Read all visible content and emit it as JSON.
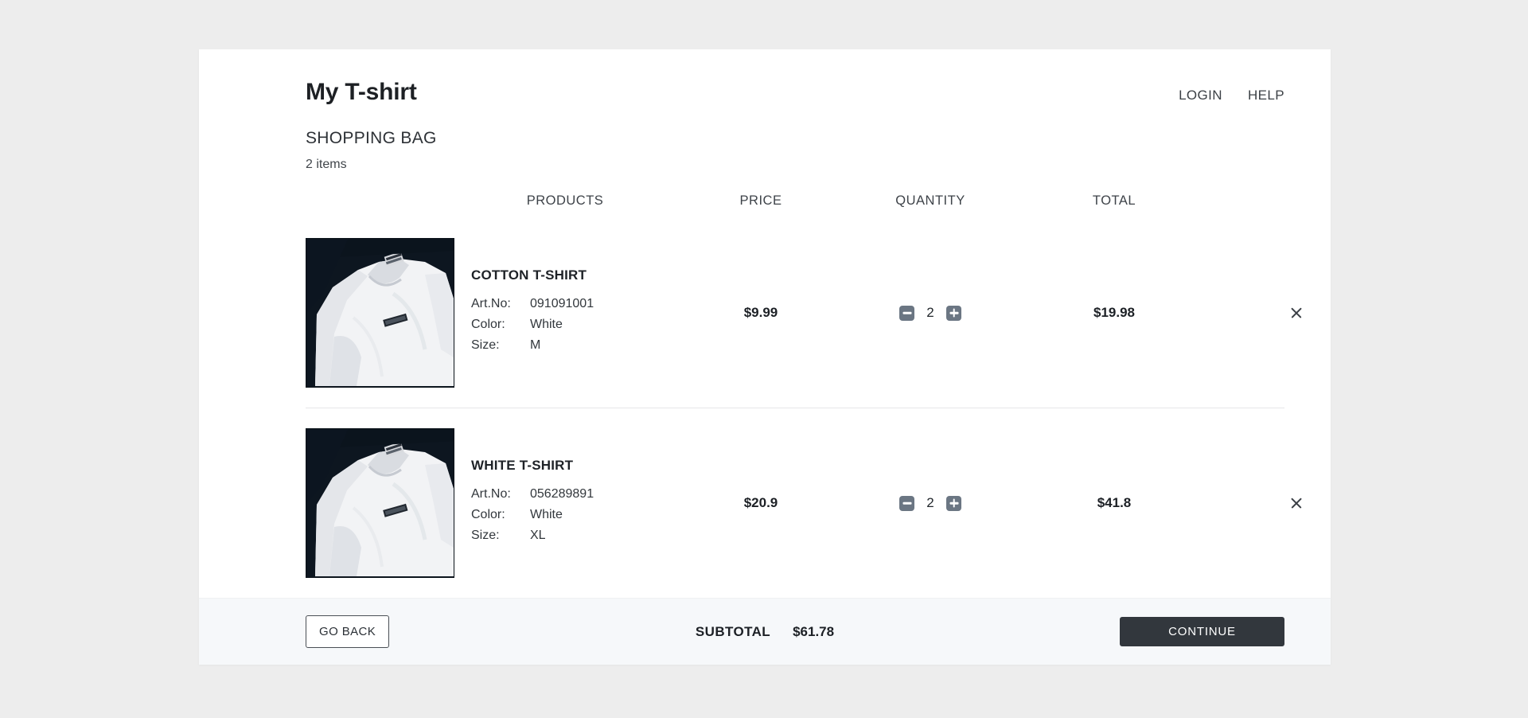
{
  "header": {
    "brand_title": "My T-shirt",
    "nav": [
      {
        "label": "LOGIN",
        "name": "login"
      },
      {
        "label": "HELP",
        "name": "help"
      }
    ]
  },
  "bag": {
    "title": "SHOPPING BAG",
    "item_count_text": "2 items",
    "columns": {
      "products": "PRODUCTS",
      "price": "PRICE",
      "quantity": "QUANTITY",
      "total": "TOTAL"
    },
    "items": [
      {
        "name": "COTTON T-SHIRT",
        "art_no_label": "Art.No:",
        "art_no_value": "091091001",
        "color_label": "Color:",
        "color_value": "White",
        "size_label": "Size:",
        "size_value": "M",
        "price": "$9.99",
        "quantity": "2",
        "total": "$19.98",
        "decrement_label": "minus-icon",
        "increment_label": "plus-icon",
        "remove_label": "close-icon",
        "image_alt": "white cotton t-shirt on dark background"
      },
      {
        "name": "WHITE T-SHIRT",
        "art_no_label": "Art.No:",
        "art_no_value": "056289891",
        "color_label": "Color:",
        "color_value": "White",
        "size_label": "Size:",
        "size_value": "XL",
        "price": "$20.9",
        "quantity": "2",
        "total": "$41.8",
        "decrement_label": "minus-icon",
        "increment_label": "plus-icon",
        "remove_label": "close-icon",
        "image_alt": "white t-shirt on dark background"
      }
    ]
  },
  "footer": {
    "go_back_label": "GO BACK",
    "subtotal_label": "SUBTOTAL",
    "subtotal_value": "$61.78",
    "continue_label": "CONTINUE"
  },
  "colors": {
    "page_background": "#ededed",
    "card_background": "#ffffff",
    "footer_background": "#f6f8fa",
    "continue_button": "#32373d",
    "stepper_button": "#6b7683",
    "text_primary": "#1c2025",
    "divider": "#e6e7e9"
  }
}
